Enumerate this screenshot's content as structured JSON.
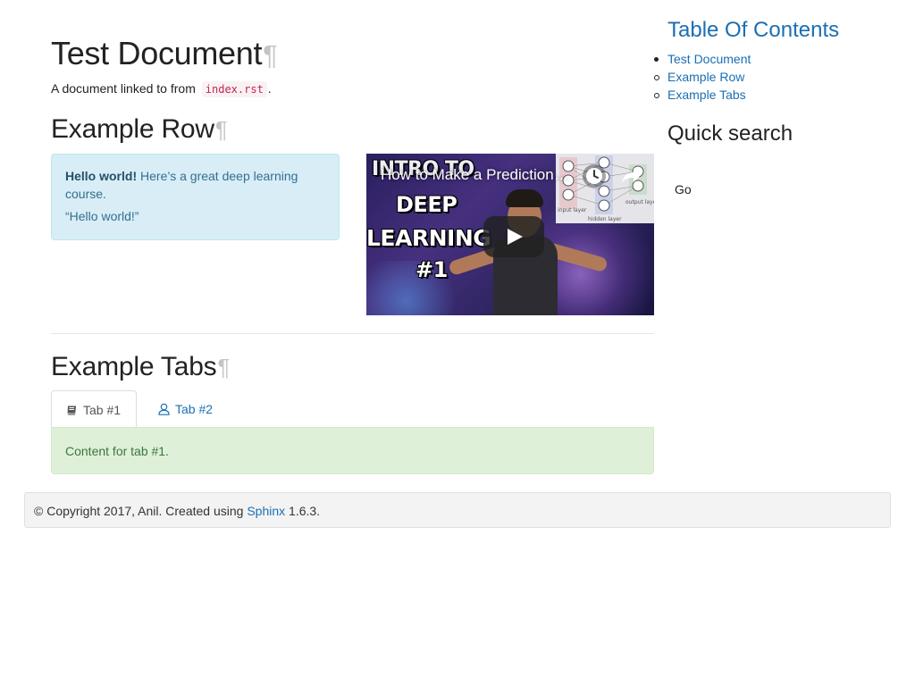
{
  "document": {
    "title": "Test Document",
    "pilcrow": "¶",
    "intro_prefix": "A document linked to from",
    "intro_code": "index.rst",
    "intro_suffix": "."
  },
  "example_row": {
    "heading": "Example Row",
    "alert": {
      "bold": "Hello world!",
      "text": " Here’s a great deep learning course.",
      "quote": "“Hello world!”"
    },
    "video": {
      "title": "How to Make a Prediction…",
      "thumbnail_lines": [
        "INTRO TO",
        "DEEP",
        "LEARNING",
        "#1"
      ],
      "diagram_labels": [
        "input layer",
        "hidden layer",
        "output layer"
      ]
    }
  },
  "example_tabs": {
    "heading": "Example Tabs",
    "tabs": [
      {
        "label": "Tab #1",
        "icon": "book-icon",
        "active": true
      },
      {
        "label": "Tab #2",
        "icon": "user-icon",
        "active": false
      }
    ],
    "content": "Content for tab #1."
  },
  "sidebar": {
    "toc_title": "Table Of Contents",
    "toc_items": [
      {
        "label": "Test Document",
        "level": 1
      },
      {
        "label": "Example Row",
        "level": 2
      },
      {
        "label": "Example Tabs",
        "level": 2
      }
    ],
    "search_title": "Quick search",
    "search_value": "",
    "go_label": "Go"
  },
  "footer": {
    "prefix": "© Copyright 2017, Anil. Created using ",
    "link": "Sphinx",
    "suffix": " 1.6.3."
  },
  "colors": {
    "link": "#1a6fb4",
    "info_bg": "#d9edf7",
    "success_bg": "#dff0d8",
    "code_text": "#c7254e"
  }
}
